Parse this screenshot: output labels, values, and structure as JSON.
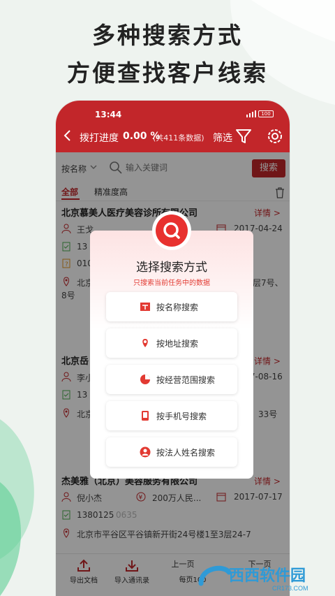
{
  "promo": {
    "line1": "多种搜索方式",
    "line2": "方便查找客户线索"
  },
  "status_bar": {
    "time": "13:44",
    "battery": "100"
  },
  "app_bar": {
    "title": "拨打进度",
    "progress_pct": "0.00 %",
    "total": "(共411条数据)",
    "filter_label": "筛选"
  },
  "search": {
    "field": "按名称",
    "placeholder": "输入关键词",
    "button": "搜索"
  },
  "tabs": {
    "all": "全部",
    "precision": "精准度高"
  },
  "cards": [
    {
      "name": "北京慕美人医疗美容诊所有限公司",
      "detail": "详情 >",
      "person": "王戈",
      "date": "2017-04-24",
      "phone": "13",
      "phone2": "010",
      "address_start": "北京",
      "address_end": "8号",
      "address_tail": "层7号、"
    },
    {
      "name": "北京岳",
      "detail": "详情 >",
      "person": "李小",
      "date": "2017-08-16",
      "phone": "13",
      "address_start": "北京",
      "address_tail": "33号"
    },
    {
      "name": "杰美雅（北京）美容服务有限公司",
      "detail": "详情 >",
      "person": "倪小杰",
      "capital": "200万人民...",
      "date": "2017-07-17",
      "phone": "1380125",
      "phone_masked": "0635",
      "address": "北京市平谷区平谷镇新开街24号楼1至3层24-7"
    }
  ],
  "bottom_bar": {
    "export": "导出文档",
    "import": "导入通讯录",
    "prev": "上一页",
    "per_page": "每页100",
    "next": "下一页"
  },
  "dialog": {
    "title": "选择搜索方式",
    "subtitle": "只搜索当前任务中的数据",
    "options": [
      {
        "label": "按名称搜索",
        "icon": "name-search-icon"
      },
      {
        "label": "按地址搜索",
        "icon": "location-pin-icon"
      },
      {
        "label": "按经营范围搜索",
        "icon": "pie-chart-icon"
      },
      {
        "label": "按手机号搜索",
        "icon": "mobile-phone-icon"
      },
      {
        "label": "按法人姓名搜索",
        "icon": "person-icon"
      }
    ]
  },
  "watermark": {
    "brand": "西西软件园",
    "site": "CR173.COM"
  },
  "colors": {
    "brand_red": "#c2262a",
    "accent_red": "#e8312f",
    "mint_bg": "#eef3ef"
  }
}
